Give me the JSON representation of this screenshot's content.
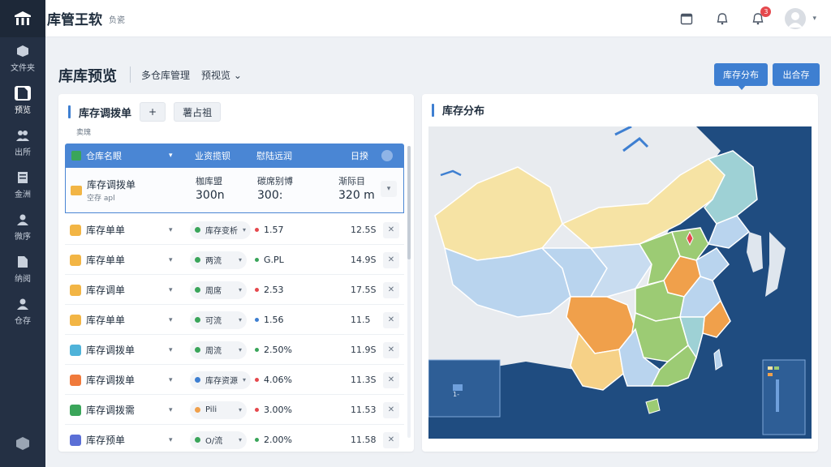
{
  "app": {
    "title": "库管王软",
    "subtitle": "负瓷"
  },
  "sidebar": {
    "items": [
      {
        "label": "文件夹",
        "icon": "box-icon"
      },
      {
        "label": "预览",
        "icon": "document-icon"
      },
      {
        "label": "出所",
        "icon": "users-icon"
      },
      {
        "label": "金洲",
        "icon": "report-icon"
      },
      {
        "label": "微序",
        "icon": "people-icon"
      },
      {
        "label": "纳阅",
        "icon": "file-icon"
      },
      {
        "label": "仓存",
        "icon": "person-icon"
      }
    ]
  },
  "topbar": {
    "notification_count": "3"
  },
  "page": {
    "title": "库库预览",
    "crumb": "多仓库管理",
    "view": "预视览 ⌄",
    "btn_distribution": "库存分布",
    "btn_export": "出合存"
  },
  "left": {
    "title": "库存调拨单",
    "add_label": "+",
    "action_label": "薯占祖",
    "note": "卖瑰",
    "header": {
      "col1": "仓库名眼",
      "col2": "业资揽钡",
      "col3": "慰陆远润",
      "col4": "日揆"
    },
    "highlight": {
      "name": "库存调拨单",
      "sub": "空存 apl",
      "c1_label": "枷库盟",
      "c1_val": "300n",
      "c2_label": "碳席别博",
      "c2_val": "300:",
      "c3_label": "渐际目",
      "c3_val": "320 m"
    },
    "rows": [
      {
        "name": "库存单单",
        "chip": "库存变析",
        "stat": "1.57",
        "num": "12.5S"
      },
      {
        "name": "库存单单",
        "chip": "两流",
        "stat": "G.PL",
        "num": "14.9S"
      },
      {
        "name": "库存调单",
        "chip": "周席",
        "stat": "2.53",
        "num": "17.5S"
      },
      {
        "name": "库存单单",
        "chip": "可流",
        "stat": "1.56",
        "num": "11.5"
      },
      {
        "name": "库存调拨单",
        "chip": "周流",
        "stat": "2.50%",
        "num": "11.9S"
      },
      {
        "name": "库存调拨单",
        "chip": "库存资源",
        "stat": "4.06%",
        "num": "11.3S"
      },
      {
        "name": "库存调拨需",
        "chip": "Pili",
        "stat": "3.00%",
        "num": "11.53"
      },
      {
        "name": "库存预单",
        "chip": "O/流",
        "stat": "2.00%",
        "num": "11.58"
      }
    ]
  },
  "right": {
    "title": "库存分布",
    "map_label": "1-"
  },
  "colors": {
    "accent": "#3e7fd1",
    "sidebar": "#243044",
    "map_ocean": "#1f4c80",
    "map_yellow": "#f6e3a4",
    "map_lightblue": "#b9d4ee",
    "map_green": "#9ccb74",
    "map_orange": "#f0a04b",
    "map_teal": "#9ed1d5"
  }
}
